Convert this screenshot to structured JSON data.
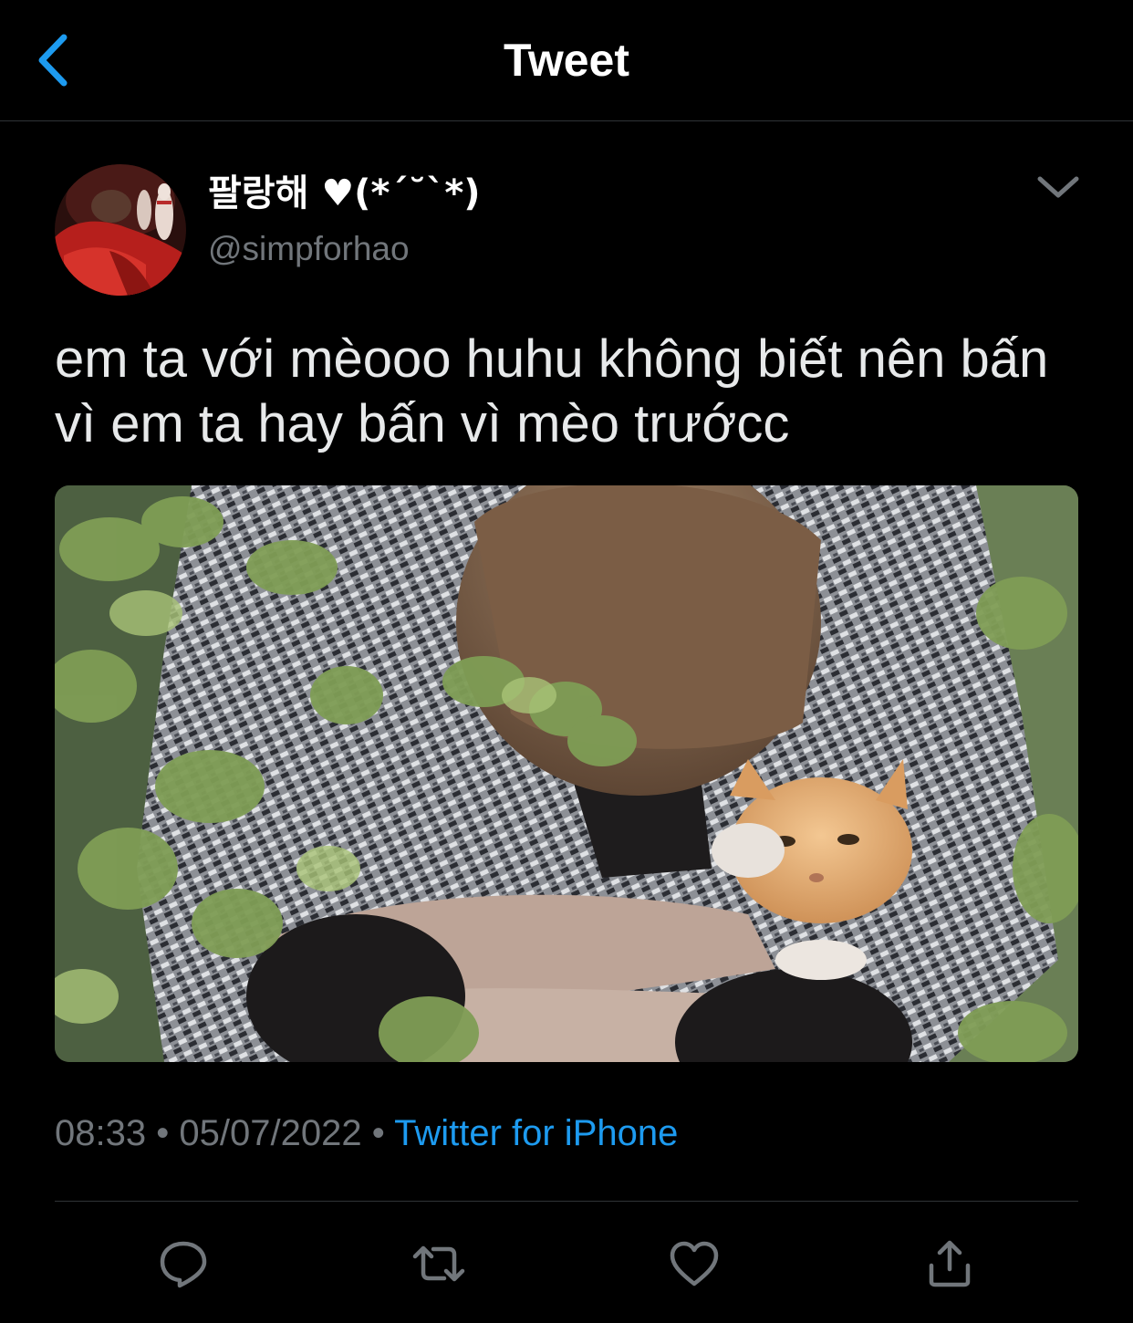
{
  "header": {
    "title": "Tweet",
    "back_icon": "chevron-left-icon"
  },
  "author": {
    "display_name": "팔랑해 ♥(*ˊ˘ˋ*)",
    "handle": "@simpforhao"
  },
  "tweet": {
    "text": "em ta với mèooo huhu không biết nên bấn vì em ta hay bấn vì mèo trướcc"
  },
  "meta": {
    "time": "08:33",
    "date": "05/07/2022",
    "separator": "•",
    "source": "Twitter for iPhone"
  },
  "actions": [
    {
      "name": "reply-icon"
    },
    {
      "name": "retweet-icon"
    },
    {
      "name": "like-icon"
    },
    {
      "name": "share-icon"
    }
  ],
  "colors": {
    "background": "#000000",
    "accent": "#1d9bf0",
    "secondary_text": "#71767b",
    "divider": "#2f3336"
  }
}
